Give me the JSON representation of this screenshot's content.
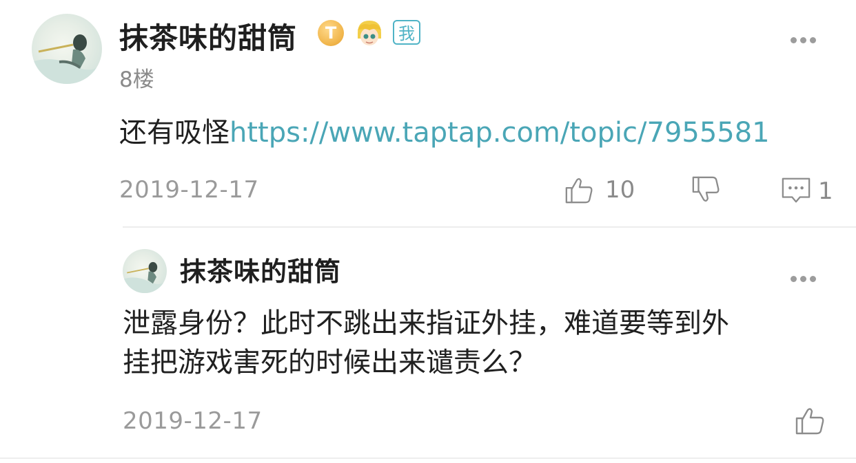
{
  "comment": {
    "username": "抹茶味的甜筒",
    "badges": {
      "level_badge": "T",
      "owner_badge": "我"
    },
    "floor": "8楼",
    "text": "还有吸怪",
    "link": "https://www.taptap.com/topic/7955581",
    "date": "2019-12-17",
    "like_count": "10",
    "reply_count": "1"
  },
  "reply": {
    "username": "抹茶味的甜筒",
    "text_line1": "泄露身份？此时不跳出来指证外挂，难道要等到外",
    "text_line2": "挂把游戏害死的时候出来谴责么？",
    "date": "2019-12-17"
  },
  "icons": {
    "like": "thumbs-up-icon",
    "dislike": "thumbs-down-icon",
    "reply": "comment-bubble-icon",
    "more": "more-dots-icon"
  },
  "colors": {
    "link": "#4aa6b6",
    "badge_outline": "#4fb3c6",
    "badge_gold": "#f1b64c",
    "meta_gray": "#9a9a9a"
  }
}
